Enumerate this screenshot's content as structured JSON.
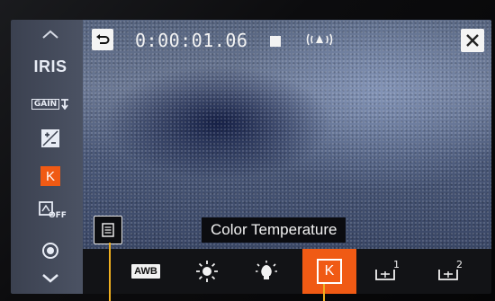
{
  "left_menu": {
    "iris_label": "IRIS",
    "gain_label": "GAIN",
    "kelvin_label": "K",
    "off_label": "OFF"
  },
  "status": {
    "timecode": "0:00:01.06"
  },
  "tooltip": {
    "text": "Color Temperature"
  },
  "bottom_menu": {
    "awb_label": "AWB",
    "kelvin_label": "K",
    "set1_sub": "1",
    "set2_sub": "2"
  },
  "colors": {
    "accent": "#f05a14",
    "pointer": "#f0b020"
  }
}
